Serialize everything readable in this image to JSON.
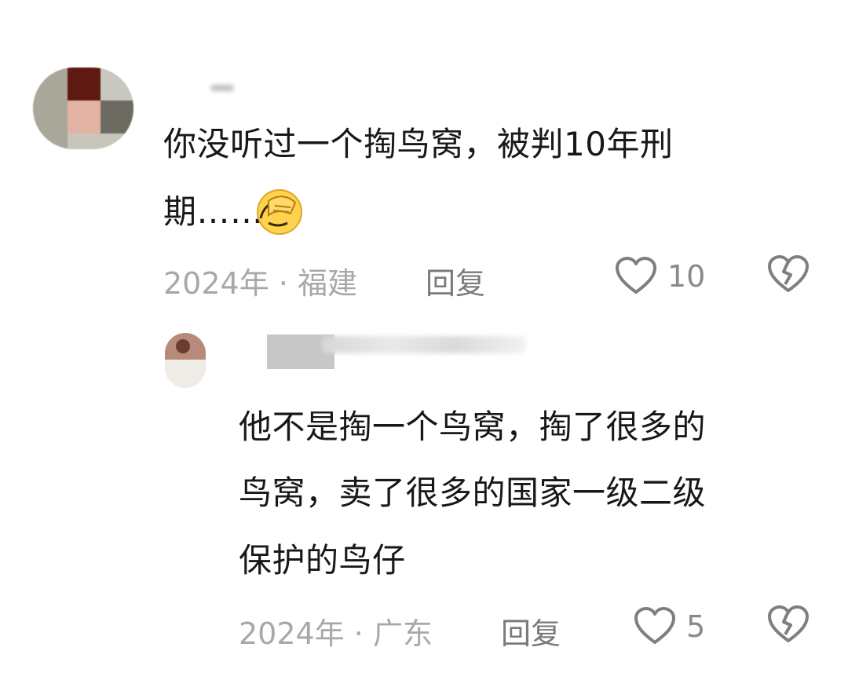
{
  "comments": [
    {
      "text_line1": "你没听过一个掏鸟窝，被判10年刑",
      "text_line2": "期……",
      "meta": "2024年 · 福建",
      "reply_label": "回复",
      "likes": "10",
      "emoji": "facepalm-emoji"
    },
    {
      "text_line1": "他不是掏一个鸟窝，掏了很多的",
      "text_line2": "鸟窝，卖了很多的国家一级二级",
      "text_line3": "保护的鸟仔",
      "meta": "2024年 · 广东",
      "reply_label": "回复",
      "likes": "5"
    }
  ],
  "icons": {
    "like": "heart-outline-icon",
    "dislike": "broken-heart-icon"
  }
}
